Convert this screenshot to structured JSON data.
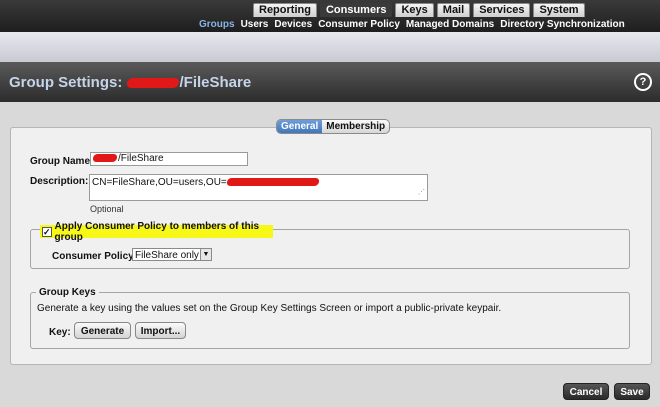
{
  "main_nav": [
    {
      "label": "Reporting"
    },
    {
      "label": "Consumers"
    },
    {
      "label": "Keys"
    },
    {
      "label": "Mail"
    },
    {
      "label": "Services"
    },
    {
      "label": "System"
    }
  ],
  "active_main_nav": "Consumers",
  "sub_nav": [
    {
      "label": "Groups"
    },
    {
      "label": "Users"
    },
    {
      "label": "Devices"
    },
    {
      "label": "Consumer Policy"
    },
    {
      "label": "Managed Domains"
    },
    {
      "label": "Directory Synchronization"
    }
  ],
  "active_sub_nav": "Groups",
  "page": {
    "title_prefix": "Group Settings:",
    "title_suffix": "/FileShare",
    "help_icon": "question-icon",
    "help_label": "?"
  },
  "tabs": [
    {
      "label": "General"
    },
    {
      "label": "Membership"
    }
  ],
  "active_tab": "General",
  "form": {
    "group_name_label": "Group Name:",
    "group_name_value": "/FileShare",
    "description_label": "Description:",
    "description_value": "CN=FileShare,OU=users,OU=",
    "description_hint": "Optional",
    "apply_policy_label": "Apply Consumer Policy to members of this group",
    "apply_policy_checked": true,
    "consumer_policy_label": "Consumer Policy:",
    "consumer_policy_value": "FileShare only"
  },
  "group_keys": {
    "legend": "Group Keys",
    "description": "Generate a key using the values set on the Group Key Settings Screen or import a public-private keypair.",
    "key_label": "Key:",
    "generate_label": "Generate",
    "import_label": "Import..."
  },
  "footer": {
    "cancel_label": "Cancel",
    "save_label": "Save"
  },
  "colors": {
    "highlight": "#f7f718",
    "redaction": "#e01818",
    "active_tab": "#3f76bd"
  }
}
